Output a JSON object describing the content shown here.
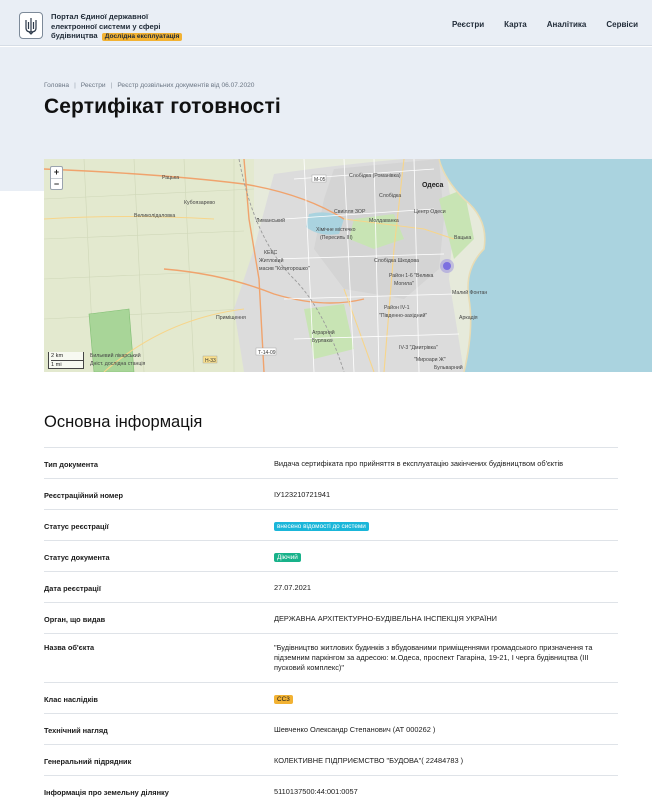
{
  "header": {
    "portal_title": "Портал Єдиної державної електронної системи у сфері будівництва",
    "trial_badge": "Дослідна експлуатація",
    "nav": [
      "Реєстри",
      "Карта",
      "Аналітика",
      "Сервіси"
    ]
  },
  "breadcrumb": [
    "Головна",
    "Реєстри",
    "Реєстр дозвільних документів від 06.07.2020"
  ],
  "page_title": "Сертифікат готовності",
  "map": {
    "zoom_in": "+",
    "zoom_out": "−",
    "scale": [
      "2 km",
      "1 mi"
    ],
    "labels": [
      "Слобідка (Романівка)",
      "Одеса",
      "Слобідка",
      "Центр Одеси",
      "Молдаванка",
      "Свиілля ЗОР",
      "Хімічне містечко (Пересипь ІІІ)",
      "Лиманський",
      "Кубоязарево",
      "Кракл",
      "Рацька",
      "Житловий масив \"Хаджибей\"",
      "КЕКС Житловий масив \"Котигорошко\"",
      "Слобідка Шкодова",
      "Вацька",
      "Район 1-6 \"Велика Могила\"",
      "Район IV-1 \"Південно-західний\"",
      "Малий Фонтан",
      "Аркадія",
      "Приміщення",
      "Лісопосадка",
      "Ю Дмитрівка",
      "Мироари Ж",
      "Бульварний",
      "М-05",
      "Н-33",
      "Т-14-09",
      "Аграрний",
      "Бурлака",
      "Бильевий лікарський",
      "Дніст. дослідна станція",
      "Великолідаловка",
      "Ю-С-Маршівський"
    ]
  },
  "info": {
    "title": "Основна інформація",
    "rows": [
      {
        "label": "Тип документа",
        "value": "Видача сертифіката про прийняття в експлуатацію закінчених будівництвом об'єктів"
      },
      {
        "label": "Реєстраційний номер",
        "value": "ІУ123210721941"
      },
      {
        "label": "Статус реєстрації",
        "badge": "внесено відомості до системи",
        "badge_color": "#1ab6d9"
      },
      {
        "label": "Статус документа",
        "badge": "Діючий",
        "badge_color": "#18b28a"
      },
      {
        "label": "Дата реєстрації",
        "value": "27.07.2021"
      },
      {
        "label": "Орган, що видав",
        "value": "ДЕРЖАВНА АРХІТЕКТУРНО-БУДІВЕЛЬНА ІНСПЕКЦІЯ УКРАЇНИ"
      },
      {
        "label": "Назва об'єкта",
        "value": "\"Будівництво житлових будинків з вбудованими приміщеннями громадського призначення та підземним паркінгом за адресою: м.Одеса, проспект Гагаріна, 19-21, І черга будівництва (ІІІ пусковий комплекс)\""
      },
      {
        "label": "Клас наслідків",
        "badge": "СС3",
        "badge_color": "#f2b233"
      },
      {
        "label": "Технічний нагляд",
        "value": "Шевченко Олександр Степанович (АТ 000262 )"
      },
      {
        "label": "Генеральний підрядник",
        "value": "КОЛЕКТИВНЕ ПІДПРИЄМСТВО \"БУДОВА\"( 22484783 )"
      },
      {
        "label": "Інформація про земельну ділянку",
        "value": "5110137500:44:001:0057"
      }
    ]
  },
  "colors": {
    "header_bg": "#e9eef5",
    "sea": "#aad3df",
    "park": "#a8d598",
    "marker": "#7b6ee0"
  }
}
